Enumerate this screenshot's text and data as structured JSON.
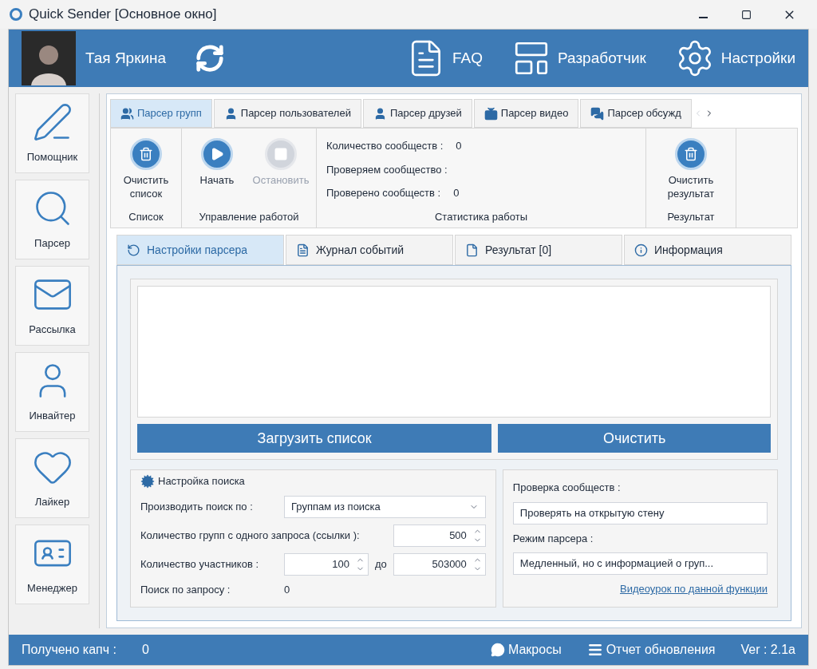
{
  "window": {
    "title": "Quick Sender [Основное окно]"
  },
  "header": {
    "user_name": "Тая Яркина",
    "links": [
      {
        "kind": "faq",
        "label": "FAQ"
      },
      {
        "kind": "developer",
        "label": "Разработчик"
      },
      {
        "kind": "settings",
        "label": "Настройки"
      }
    ]
  },
  "sidebar": {
    "items": [
      {
        "kind": "helper",
        "label": "Помощник"
      },
      {
        "kind": "parser",
        "label": "Парсер"
      },
      {
        "kind": "mail",
        "label": "Рассылка"
      },
      {
        "kind": "inviter",
        "label": "Инвайтер"
      },
      {
        "kind": "liker",
        "label": "Лайкер"
      },
      {
        "kind": "manager",
        "label": "Менеджер"
      }
    ]
  },
  "tabs": [
    {
      "kind": "groups",
      "label": "Парсер групп",
      "selected": true
    },
    {
      "kind": "user",
      "label": "Парсер пользователей",
      "selected": false
    },
    {
      "kind": "user",
      "label": "Парсер друзей",
      "selected": false
    },
    {
      "kind": "video",
      "label": "Парсер видео",
      "selected": false
    },
    {
      "kind": "chat",
      "label": "Парсер обсужд",
      "selected": false
    }
  ],
  "ribbon": {
    "groups": [
      {
        "caption": "Список",
        "buttons": [
          {
            "kind": "trash",
            "label": "Очистить список",
            "disabled": false
          }
        ]
      },
      {
        "caption": "Управление работой",
        "buttons": [
          {
            "kind": "play",
            "label": "Начать",
            "disabled": false
          },
          {
            "kind": "stop",
            "label": "Остановить",
            "disabled": true
          }
        ]
      }
    ],
    "stats": {
      "caption": "Статистика работы",
      "rows": [
        {
          "label": "Количество сообществ :",
          "value": "0"
        },
        {
          "label": "Проверяем сообщество :"
        },
        {
          "label": "Проверено сообществ  :",
          "value": "0"
        }
      ]
    },
    "result": {
      "caption": "Результат",
      "button": {
        "kind": "trash",
        "label": "Очистить результат",
        "disabled": false
      }
    }
  },
  "inner_tabs": [
    {
      "kind": "settings",
      "label": "Настройки парсера",
      "selected": true
    },
    {
      "kind": "log",
      "label": "Журнал событий",
      "selected": false
    },
    {
      "kind": "file",
      "label": "Результат [0]",
      "selected": false
    },
    {
      "kind": "info",
      "label": "Информация",
      "selected": false
    }
  ],
  "list_buttons": [
    "Загрузить список",
    "Очистить"
  ],
  "search_settings": {
    "title": "Настройка поиска",
    "search_by_label": "Производить поиск по :",
    "search_by": "Группам из поиска",
    "groups_per_query_label": "Количество групп с одного запроса (ссылки ):",
    "groups_per_query": "500",
    "members_label": "Количество участников :",
    "members_from": "100",
    "members_to_label": "до",
    "members_to": "503000",
    "query_label": "Поиск по запросу :",
    "query_value": "0"
  },
  "check": {
    "check_label": "Проверка сообществ :",
    "check_value": "Проверять на открытую стену",
    "mode_label": "Режим парсера :",
    "mode_value": "Медленный, но с информацией о груп...",
    "video_link": "Видеоурок по данной функции"
  },
  "status_bar": {
    "captcha_label": "Получено капч :",
    "captcha_value": "0",
    "macros": "Макросы",
    "update_report": "Отчет обновления",
    "version": "Ver : 2.1a"
  }
}
